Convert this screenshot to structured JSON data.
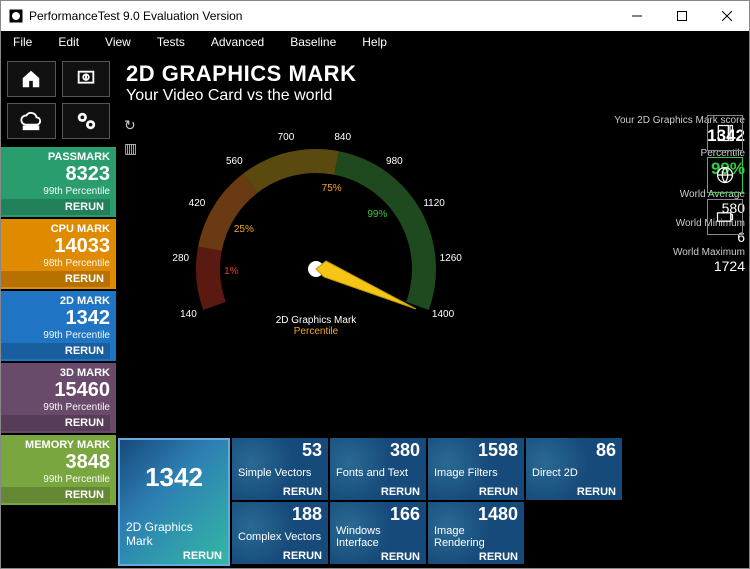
{
  "title": "PerformanceTest 9.0 Evaluation Version",
  "menu": {
    "file": "File",
    "edit": "Edit",
    "view": "View",
    "tests": "Tests",
    "advanced": "Advanced",
    "baseline": "Baseline",
    "help": "Help"
  },
  "header": {
    "title": "2D GRAPHICS MARK",
    "subtitle": "Your Video Card vs the world"
  },
  "summary": [
    {
      "label": "PASSMARK",
      "score": "8323",
      "pct": "99th Percentile",
      "rerun": "RERUN",
      "color": "#2a9d6f"
    },
    {
      "label": "CPU MARK",
      "score": "14033",
      "pct": "98th Percentile",
      "rerun": "RERUN",
      "color": "#e08a00"
    },
    {
      "label": "2D MARK",
      "score": "1342",
      "pct": "99th Percentile",
      "rerun": "RERUN",
      "color": "#1f74c4"
    },
    {
      "label": "3D MARK",
      "score": "15460",
      "pct": "99th Percentile",
      "rerun": "RERUN",
      "color": "#6a4a6a"
    },
    {
      "label": "MEMORY MARK",
      "score": "3848",
      "pct": "99th Percentile",
      "rerun": "RERUN",
      "color": "#7aa63f"
    }
  ],
  "gauge": {
    "ticks": [
      "140",
      "280",
      "420",
      "560",
      "700",
      "840",
      "980",
      "1120",
      "1260",
      "1400"
    ],
    "pcts": {
      "p1": "1%",
      "p25": "25%",
      "p75": "75%",
      "p99": "99%"
    },
    "caption": "2D Graphics Mark",
    "subtitle": "Percentile"
  },
  "stats": {
    "scoreLbl": "Your 2D Graphics Mark score",
    "score": "1342",
    "pctLbl": "Percentile",
    "pct": "99%",
    "avgLbl": "World Average",
    "avg": "580",
    "minLbl": "World Minimum",
    "min": "6",
    "maxLbl": "World Maximum",
    "max": "1724"
  },
  "mainTest": {
    "score": "1342",
    "label": "2D Graphics Mark",
    "rerun": "RERUN"
  },
  "subTests": [
    [
      {
        "score": "53",
        "label": "Simple Vectors",
        "rerun": "RERUN"
      },
      {
        "score": "380",
        "label": "Fonts and Text",
        "rerun": "RERUN"
      },
      {
        "score": "1598",
        "label": "Image Filters",
        "rerun": "RERUN"
      },
      {
        "score": "86",
        "label": "Direct 2D",
        "rerun": "RERUN"
      }
    ],
    [
      {
        "score": "188",
        "label": "Complex Vectors",
        "rerun": "RERUN"
      },
      {
        "score": "166",
        "label": "Windows Interface",
        "rerun": "RERUN"
      },
      {
        "score": "1480",
        "label": "Image Rendering",
        "rerun": "RERUN"
      }
    ]
  ],
  "chart_data": {
    "type": "other",
    "title": "2D Graphics Mark",
    "subtitle": "Percentile",
    "range": [
      0,
      1400
    ],
    "ticks": [
      140,
      280,
      420,
      560,
      700,
      840,
      980,
      1120,
      1260,
      1400
    ],
    "percentile_marks": [
      {
        "pct": 1,
        "approx_value": 180,
        "color": "#e53935"
      },
      {
        "pct": 25,
        "approx_value": 320,
        "color": "#f5a623"
      },
      {
        "pct": 75,
        "approx_value": 760,
        "color": "#f5a623"
      },
      {
        "pct": 99,
        "approx_value": 1000,
        "color": "#2ecc40"
      }
    ],
    "needle_value": 1342,
    "score": 1342,
    "percentile": 99,
    "world_average": 580,
    "world_minimum": 6,
    "world_maximum": 1724
  }
}
